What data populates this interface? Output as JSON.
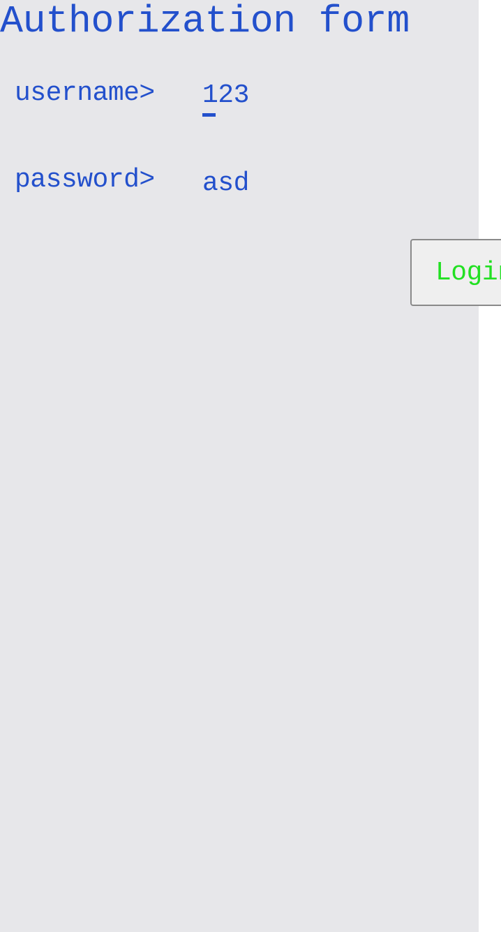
{
  "form": {
    "title": "Authorization form",
    "username_label": "username>",
    "username_value": "123",
    "password_label": "password>",
    "password_value": "asd",
    "login_label": "Login"
  },
  "colors": {
    "text": "#2350cc",
    "panel_background": "#e7e7ea",
    "button_text": "#22e022",
    "button_background": "#efefef",
    "button_border": "#8a8a8a"
  }
}
